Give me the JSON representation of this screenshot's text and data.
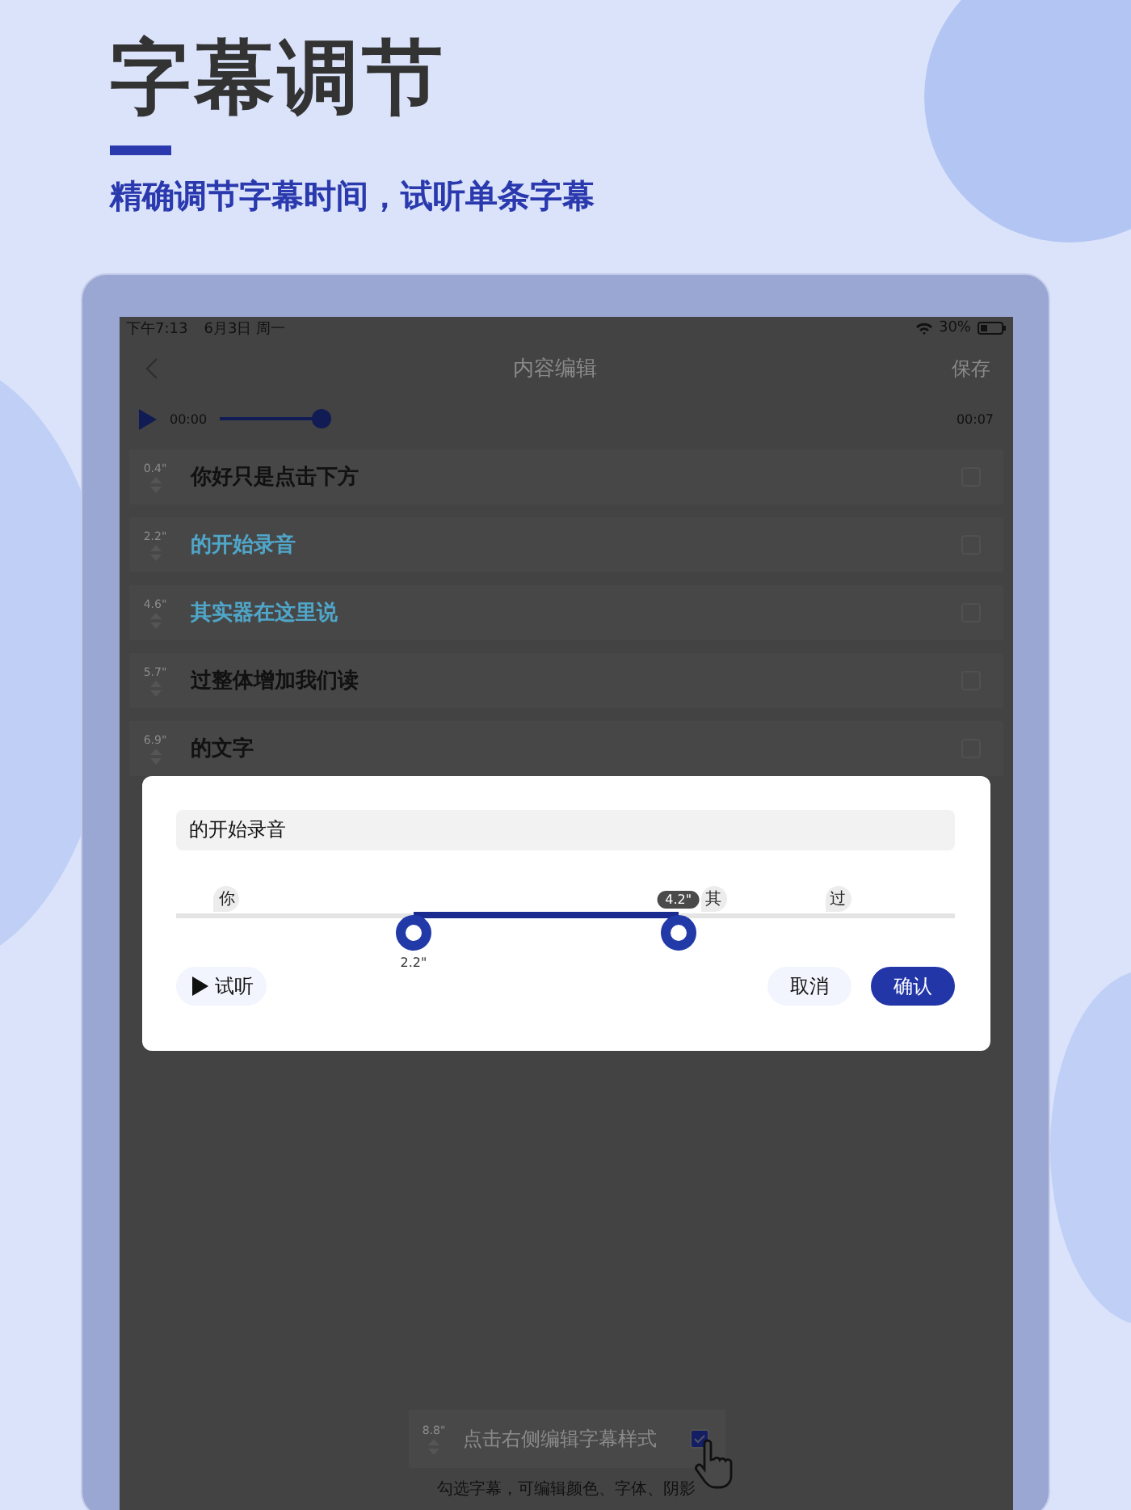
{
  "header": {
    "title": "字幕调节",
    "subtitle": "精确调节字幕时间，试听单条字幕"
  },
  "status_bar": {
    "time": "下午7:13",
    "date": "6月3日 周一",
    "battery": "30%"
  },
  "nav": {
    "title": "内容编辑",
    "action": "保存"
  },
  "player": {
    "current": "00:00",
    "total": "00:07",
    "level": 0.13
  },
  "subtitles": [
    {
      "time": "0.4\"",
      "text": "你好只是点击下方",
      "highlighted": false,
      "checked": false
    },
    {
      "time": "2.2\"",
      "text": "的开始录音",
      "highlighted": true,
      "checked": false
    },
    {
      "time": "4.6\"",
      "text": "其实器在这里说",
      "highlighted": true,
      "checked": false
    },
    {
      "time": "5.7\"",
      "text": "过整体增加我们读",
      "highlighted": false,
      "checked": false
    },
    {
      "time": "6.9\"",
      "text": "的文字",
      "highlighted": false,
      "checked": false
    }
  ],
  "dialog": {
    "value": "的开始录音",
    "markers": [
      {
        "label": "你",
        "level": 0.065
      },
      {
        "label": "其",
        "level": 0.69
      },
      {
        "label": "过",
        "level": 0.85
      }
    ],
    "handles": [
      {
        "label": "2.2\"",
        "level": 0.305,
        "bubble": false
      },
      {
        "label": "4.2\"",
        "level": 0.645,
        "bubble": true
      }
    ],
    "preview": "试听",
    "cancel": "取消",
    "confirm": "确认"
  },
  "tip": {
    "time": "8.8\"",
    "text": "点击右侧编辑字幕样式",
    "checked": true,
    "caption": "勾选字幕，可编辑颜色、字体、阴影"
  }
}
